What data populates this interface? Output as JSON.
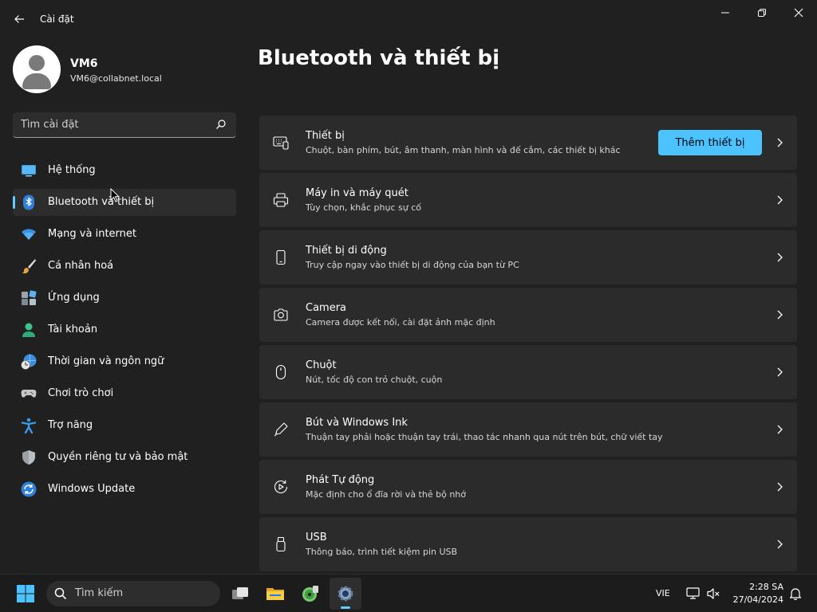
{
  "window": {
    "title": "Cài đặt"
  },
  "profile": {
    "name": "VM6",
    "email": "VM6@collabnet.local"
  },
  "search": {
    "placeholder": "Tìm cài đặt"
  },
  "nav": {
    "items": [
      {
        "label": "Hệ thống",
        "icon": "monitor-icon"
      },
      {
        "label": "Bluetooth và thiết bị",
        "icon": "bluetooth-icon",
        "active": true
      },
      {
        "label": "Mạng và internet",
        "icon": "wifi-icon"
      },
      {
        "label": "Cá nhân hoá",
        "icon": "brush-icon"
      },
      {
        "label": "Ứng dụng",
        "icon": "apps-icon"
      },
      {
        "label": "Tài khoản",
        "icon": "account-icon"
      },
      {
        "label": "Thời gian và ngôn ngữ",
        "icon": "globe-clock-icon"
      },
      {
        "label": "Chơi trò chơi",
        "icon": "gamepad-icon"
      },
      {
        "label": "Trợ năng",
        "icon": "accessibility-icon"
      },
      {
        "label": "Quyền riêng tư và bảo mật",
        "icon": "shield-icon"
      },
      {
        "label": "Windows Update",
        "icon": "update-icon"
      }
    ]
  },
  "main": {
    "title": "Bluetooth và thiết bị",
    "add_device_label": "Thêm thiết bị",
    "cards": [
      {
        "title": "Thiết bị",
        "subtitle": "Chuột, bàn phím, bút, âm thanh, màn hình và đế cắm, các thiết bị khác",
        "icon": "devices-icon"
      },
      {
        "title": "Máy in và máy quét",
        "subtitle": "Tùy chọn, khắc phục sự cố",
        "icon": "printer-icon"
      },
      {
        "title": "Thiết bị di động",
        "subtitle": "Truy cập ngay vào thiết bị di động của bạn từ PC",
        "icon": "phone-icon"
      },
      {
        "title": "Camera",
        "subtitle": "Camera được kết nối, cài đặt ảnh mặc định",
        "icon": "camera-icon"
      },
      {
        "title": "Chuột",
        "subtitle": "Nút, tốc độ con trỏ chuột, cuộn",
        "icon": "mouse-icon"
      },
      {
        "title": "Bút và Windows Ink",
        "subtitle": "Thuận tay phải hoặc thuận tay trái, thao tác nhanh qua nút trên bút, chữ viết tay",
        "icon": "pen-icon"
      },
      {
        "title": "Phát Tự động",
        "subtitle": "Mặc định cho ổ đĩa rời và thẻ bộ nhớ",
        "icon": "autoplay-icon"
      },
      {
        "title": "USB",
        "subtitle": "Thông báo, trình tiết kiệm pin USB",
        "icon": "usb-icon"
      }
    ]
  },
  "taskbar": {
    "search_label": "Tìm kiếm",
    "language": "VIE",
    "time": "2:28 SA",
    "date": "27/04/2024"
  },
  "colors": {
    "accent": "#4cc2ff",
    "background": "#202020",
    "card": "#2b2b2b"
  }
}
